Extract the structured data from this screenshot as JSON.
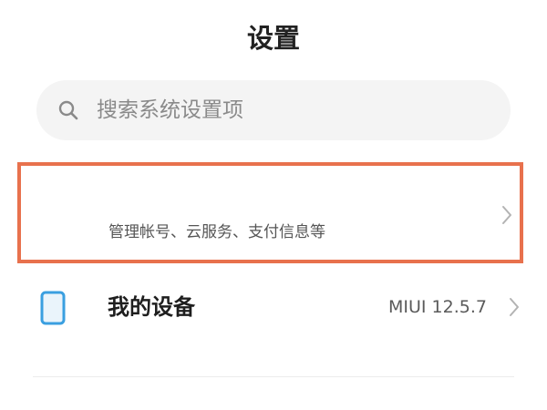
{
  "header": {
    "title": "设置"
  },
  "search": {
    "placeholder": "搜索系统设置项",
    "icon": "search-icon"
  },
  "account": {
    "subtitle": "管理帐号、云服务、支付信息等",
    "highlight_color": "#e8714d",
    "chevron_icon": "chevron-right-icon"
  },
  "device": {
    "label": "我的设备",
    "value": "MIUI 12.5.7",
    "icon": "phone-icon",
    "icon_color": "#3a9fe0",
    "chevron_icon": "chevron-right-icon"
  }
}
